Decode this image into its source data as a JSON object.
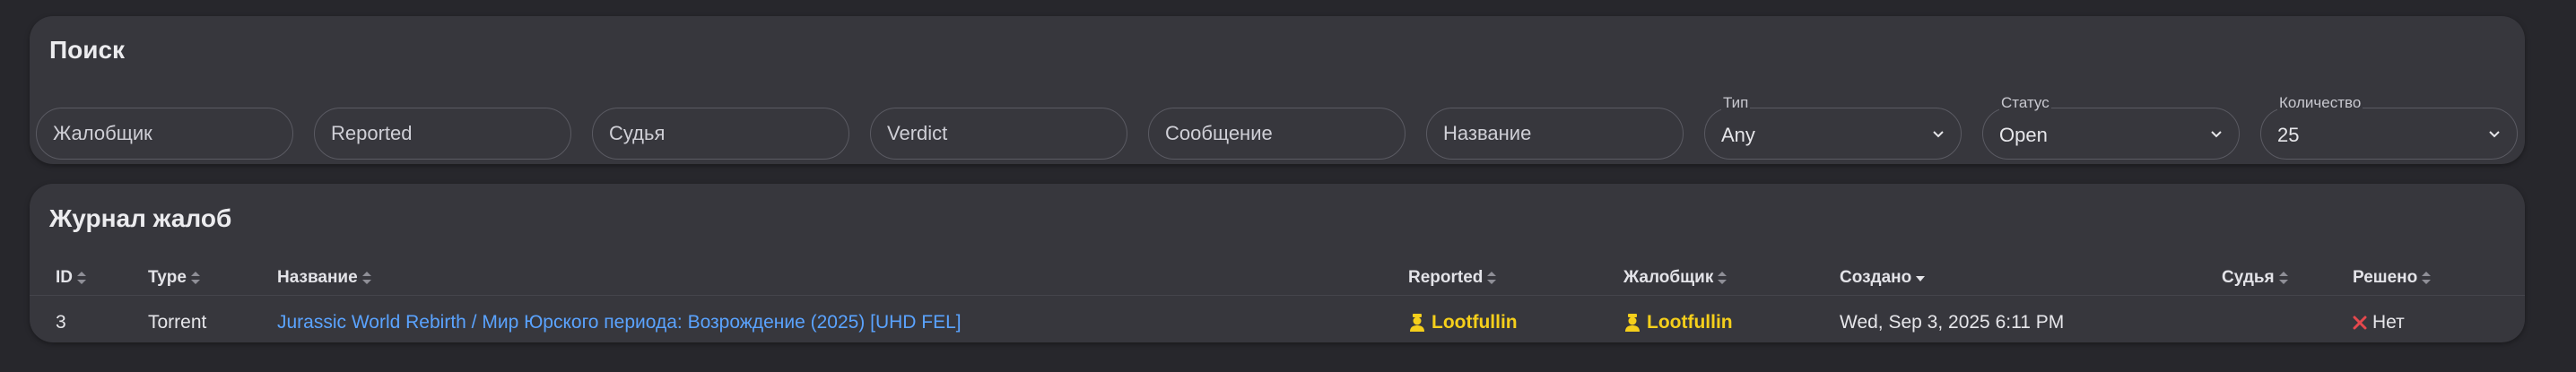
{
  "search": {
    "title": "Поиск",
    "fields": [
      {
        "placeholder": "Жалобщик"
      },
      {
        "placeholder": "Reported"
      },
      {
        "placeholder": "Судья"
      },
      {
        "placeholder": "Verdict"
      },
      {
        "placeholder": "Сообщение"
      },
      {
        "placeholder": "Название"
      }
    ],
    "selects": [
      {
        "label": "Тип",
        "value": "Any"
      },
      {
        "label": "Статус",
        "value": "Open"
      },
      {
        "label": "Количество",
        "value": "25"
      }
    ]
  },
  "log": {
    "title": "Журнал жалоб",
    "columns": {
      "id": "ID",
      "type": "Type",
      "name": "Название",
      "reported": "Reported",
      "complainant": "Жалобщик",
      "created": "Создано",
      "judge": "Судья",
      "resolved": "Решено"
    },
    "rows": [
      {
        "id": "3",
        "type": "Torrent",
        "name": "Jurassic World Rebirth / Мир Юрского периода: Возрождение (2025) [UHD FEL]",
        "reported": "Lootfullin",
        "complainant": "Lootfullin",
        "created": "Wed, Sep 3, 2025 6:11 PM",
        "judge": "",
        "resolved": "Нет"
      }
    ]
  },
  "colors": {
    "background": "#27272c",
    "card": "#37373d",
    "link": "#5aa3ff",
    "user": "#f5cf1b",
    "no": "#e5484d"
  },
  "icons": {
    "sort": "sort-icon",
    "sort_desc": "sort-desc-icon",
    "user": "user-icon",
    "no": "x-icon",
    "select": "chevron-down-icon"
  }
}
